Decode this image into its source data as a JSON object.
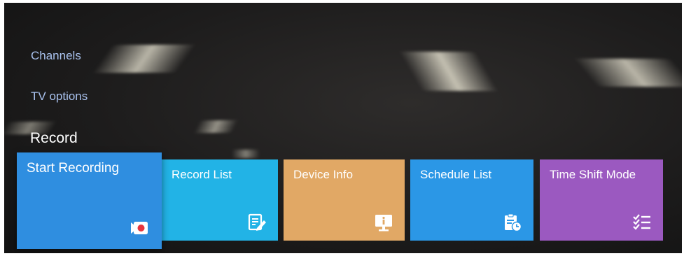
{
  "menu": {
    "items": [
      {
        "label": "Channels"
      },
      {
        "label": "TV options"
      }
    ],
    "active_section": "Record"
  },
  "tiles": [
    {
      "label": "Start Recording",
      "icon": "record-start-icon",
      "color": "#2f8ee0",
      "focused": true
    },
    {
      "label": "Record List",
      "icon": "record-list-icon",
      "color": "#22b3e6"
    },
    {
      "label": "Device Info",
      "icon": "device-info-icon",
      "color": "#e1a865"
    },
    {
      "label": "Schedule List",
      "icon": "schedule-list-icon",
      "color": "#2b97e6"
    },
    {
      "label": "Time Shift Mode",
      "icon": "time-shift-icon",
      "color": "#9b59c0"
    }
  ]
}
